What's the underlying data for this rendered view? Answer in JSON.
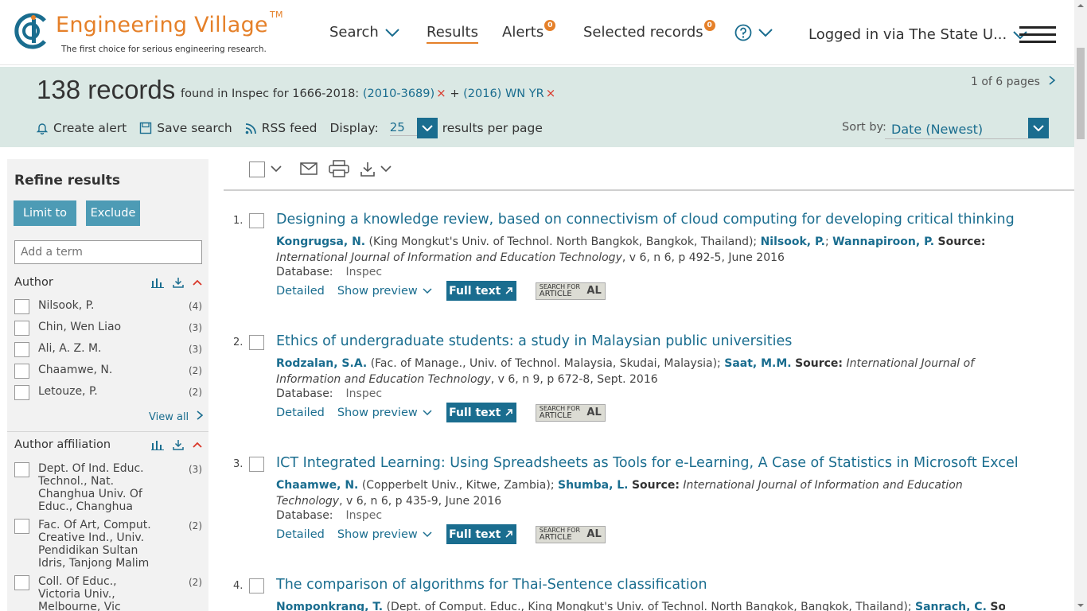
{
  "brand": {
    "title": "Engineering Village",
    "tm": "TM",
    "tagline": "The first choice for serious engineering research.",
    "accent": "#e58029",
    "teal": "#1a6d8f"
  },
  "nav": {
    "search": "Search",
    "results": "Results",
    "alerts": "Alerts",
    "alerts_count": "0",
    "selected": "Selected records",
    "selected_count": "0",
    "login": "Logged in via The State U...",
    "help_icon": "help-circle-icon"
  },
  "summary": {
    "count": "138 records",
    "found_text": "found in Inspec for 1666-2018:",
    "query1": "(2010-3689)",
    "plus": "+",
    "query2": "(2016) WN YR",
    "remove": "×",
    "pages": "1 of 6 pages"
  },
  "toolbar": {
    "create_alert": "Create alert",
    "save_search": "Save search",
    "rss": "RSS feed",
    "display": "Display:",
    "display_value": "25",
    "per_page": "results per page",
    "sort_by": "Sort by:",
    "sort_value": "Date (Newest)"
  },
  "sidebar": {
    "title": "Refine results",
    "limit": "Limit to",
    "exclude": "Exclude",
    "term_placeholder": "Add a term",
    "author_title": "Author",
    "authors": [
      {
        "label": "Nilsook, P.",
        "count": "(4)"
      },
      {
        "label": "Chin, Wen Liao",
        "count": "(3)"
      },
      {
        "label": "Ali, A. Z. M.",
        "count": "(3)"
      },
      {
        "label": "Chaamwe, N.",
        "count": "(2)"
      },
      {
        "label": "Letouze, P.",
        "count": "(2)"
      }
    ],
    "view_all": "View all",
    "affil_title": "Author affiliation",
    "affiliations": [
      {
        "lines": [
          "Dept. Of Ind. Educ.",
          "Technol., Nat.",
          "Changhua Univ. Of",
          "Educ., Changhua"
        ],
        "count": "(3)"
      },
      {
        "lines": [
          "Fac. Of Art, Comput.",
          "Creative Ind., Univ.",
          "Pendidikan Sultan",
          "Idris, Tanjong Malim"
        ],
        "count": "(2)"
      },
      {
        "lines": [
          "Coll. Of Educ.,",
          "Victoria Univ.,",
          "Melbourne, Vic"
        ],
        "count": "(2)"
      }
    ]
  },
  "results": [
    {
      "num": "1.",
      "title": "Designing a knowledge review, based on connectivism of cloud computing for developing critical thinking",
      "authors": [
        {
          "name": "Kongrugsa, N.",
          "affil": " (King Mongkut's Univ. of Technol. North Bangkok, Bangkok, Thailand); "
        },
        {
          "name": "Nilsook, P.",
          "affil": "; "
        },
        {
          "name": "Wannapiroon, P.",
          "affil": " "
        }
      ],
      "source_label": "Source:",
      "journal": "International Journal of Information and Education Technology",
      "details": ", v 6, n 6, p 492-5, June 2016",
      "db_label": "Database:",
      "db": "Inspec",
      "detailed": "Detailed",
      "preview": "Show preview",
      "fulltext": "Full text",
      "sfa_top": "SEARCH FOR",
      "sfa_bottom": "ARTICLE",
      "sfa_al": "AL"
    },
    {
      "num": "2.",
      "title": "Ethics of undergraduate students: a study in Malaysian public universities",
      "authors": [
        {
          "name": "Rodzalan, S.A.",
          "affil": " (Fac. of Manage., Univ. of Technol. Malaysia, Skudai, Malaysia); "
        },
        {
          "name": "Saat, M.M.",
          "affil": " "
        }
      ],
      "source_label": "Source:",
      "journal": "International Journal of Information and Education Technology",
      "details": ", v 6, n 9, p 672-8, Sept. 2016",
      "db_label": "Database:",
      "db": "Inspec",
      "detailed": "Detailed",
      "preview": "Show preview",
      "fulltext": "Full text",
      "sfa_top": "SEARCH FOR",
      "sfa_bottom": "ARTICLE",
      "sfa_al": "AL"
    },
    {
      "num": "3.",
      "title": "ICT Integrated Learning: Using Spreadsheets as Tools for e-Learning, A Case of Statistics in Microsoft Excel",
      "authors": [
        {
          "name": "Chaamwe, N.",
          "affil": " (Copperbelt Univ., Kitwe, Zambia); "
        },
        {
          "name": "Shumba, L.",
          "affil": " "
        }
      ],
      "source_label": "Source:",
      "journal": "International Journal of Information and Education Technology",
      "details": ", v 6, n 6, p 435-9, June 2016",
      "db_label": "Database:",
      "db": "Inspec",
      "detailed": "Detailed",
      "preview": "Show preview",
      "fulltext": "Full text",
      "sfa_top": "SEARCH FOR",
      "sfa_bottom": "ARTICLE",
      "sfa_al": "AL"
    },
    {
      "num": "4.",
      "title": "The comparison of algorithms for Thai-Sentence classification",
      "authors": [
        {
          "name": "Nomponkrang, T.",
          "affil": " (Dept. of Comput. Educ., King Mongkut's Univ. of Technol. North Bangkok, Bangkok, Thailand); "
        },
        {
          "name": "Sanrach, C.",
          "affil": " "
        }
      ],
      "source_label": "Source:"
    }
  ]
}
